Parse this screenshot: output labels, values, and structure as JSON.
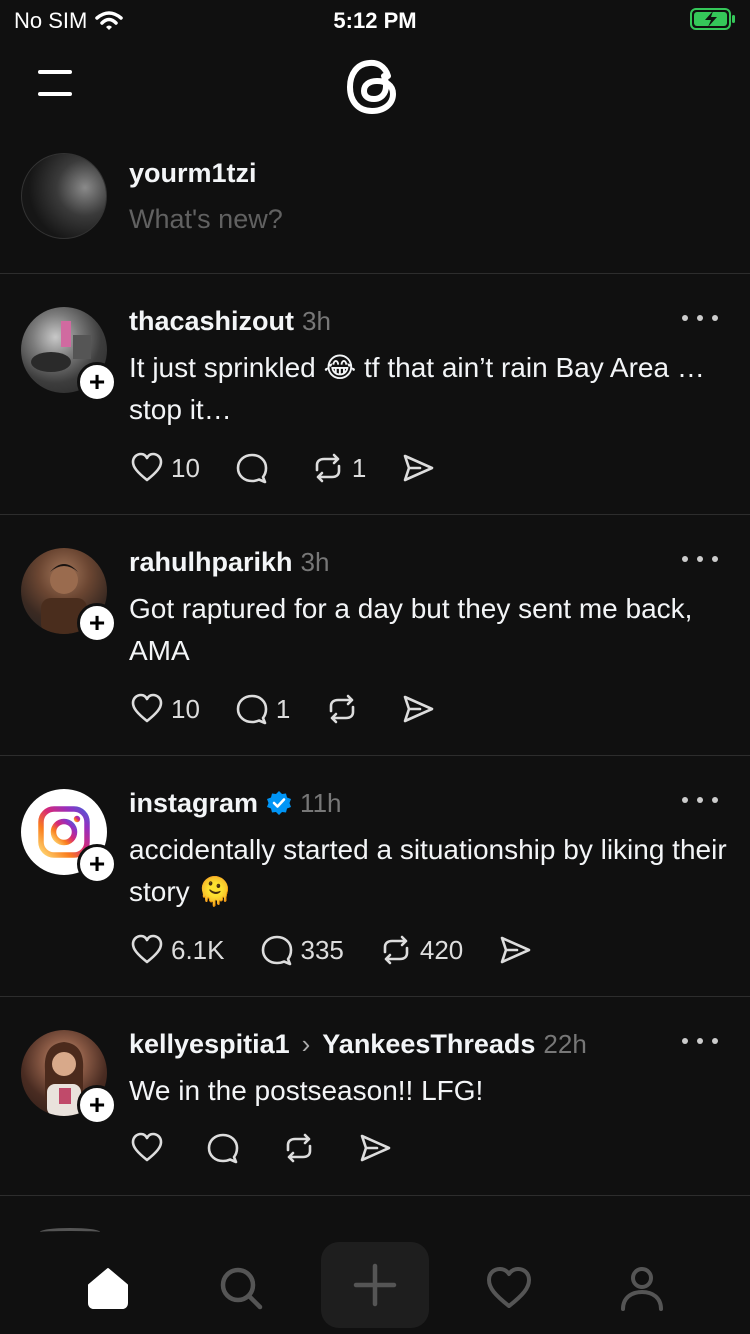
{
  "status": {
    "carrier": "No SIM",
    "time": "5:12 PM"
  },
  "composer": {
    "username": "yourm1tzi",
    "placeholder": "What's new?"
  },
  "posts": [
    {
      "username": "thacashizout",
      "time": "3h",
      "text": "It just sprinkled 😂 tf that ain’t rain Bay Area … stop it…",
      "likes": "10",
      "replies": "",
      "reposts": "1"
    },
    {
      "username": "rahulhparikh",
      "time": "3h",
      "text": "Got raptured for a day but they sent me back, AMA",
      "likes": "10",
      "replies": "1",
      "reposts": ""
    },
    {
      "username": "instagram",
      "time": "11h",
      "verified": true,
      "text": "accidentally started a situationship by liking their story 🫠",
      "likes": "6.1K",
      "replies": "335",
      "reposts": "420"
    },
    {
      "username": "kellyespitia1",
      "reply_to": "YankeesThreads",
      "time": "22h",
      "text": "We in the postseason!! LFG!",
      "likes": "",
      "replies": "",
      "reposts": ""
    }
  ],
  "tabs": [
    "home-icon",
    "search-icon",
    "create-icon",
    "activity-icon",
    "profile-icon"
  ],
  "colors": {
    "background": "#101010",
    "divider": "#2d2d2d",
    "muted": "#777777",
    "verified": "#0095f6"
  }
}
